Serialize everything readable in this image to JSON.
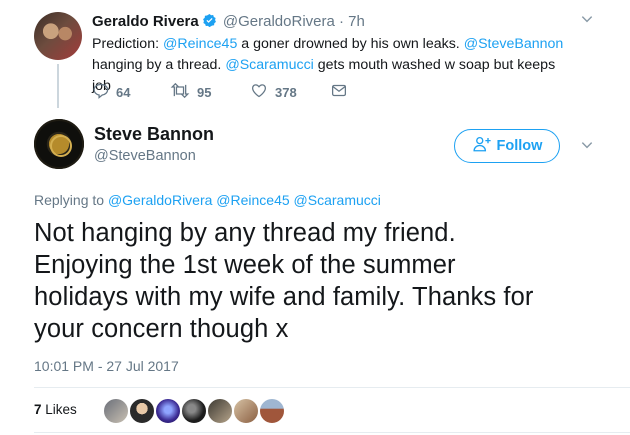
{
  "parent_tweet": {
    "author_name": "Geraldo Rivera",
    "author_handle": "@GeraldoRivera",
    "separator": "·",
    "time_ago": "7h",
    "text": {
      "prefix": "Prediction: ",
      "mention_1": "@Reince45",
      "part_2": " a goner drowned by his own leaks. ",
      "mention_2": "@SteveBannon",
      "part_3": " hanging by a thread. ",
      "mention_3": "@Scaramucci",
      "part_4": " gets mouth washed w soap but keeps job"
    },
    "actions": {
      "reply_count": "64",
      "retweet_count": "95",
      "like_count": "378"
    }
  },
  "main_tweet": {
    "author_name": "Steve Bannon",
    "author_handle": "@SteveBannon",
    "follow_label": "Follow",
    "replying_prefix": "Replying to ",
    "replying_mentions": "@GeraldoRivera @Reince45 @Scaramucci",
    "text": "Not hanging by any thread my friend.\nEnjoying the 1st week of the summer\nholidays with my wife and family.  Thanks for\nyour concern though x",
    "timestamp": "10:01 PM - 27 Jul 2017",
    "likes_count": "7",
    "likes_label": "Likes"
  },
  "colors": {
    "accent": "#1da1f2",
    "text": "#14171a",
    "muted": "#657786",
    "divider": "#e6ecf0"
  },
  "icons": [
    "verified-badge-icon",
    "chevron-down-icon",
    "reply-icon",
    "retweet-icon",
    "like-icon",
    "dm-envelope-icon",
    "follow-person-plus-icon"
  ]
}
